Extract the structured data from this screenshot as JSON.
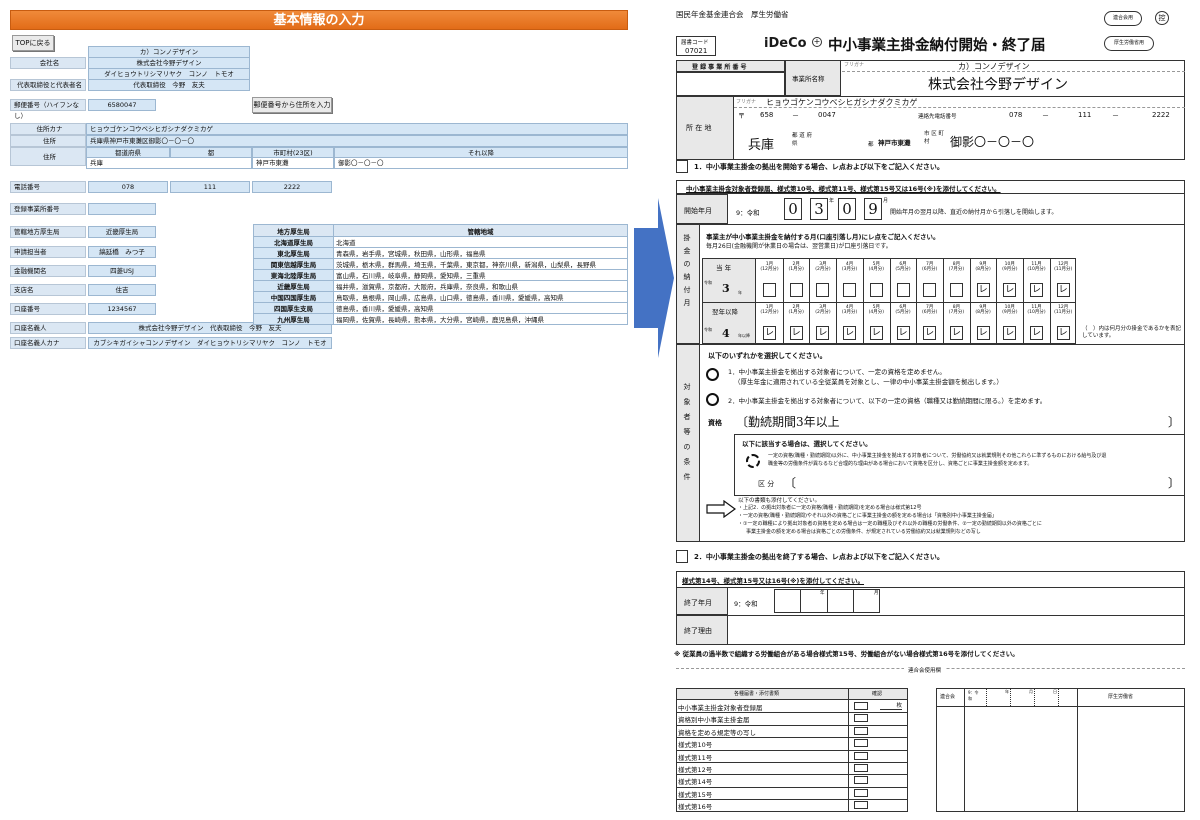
{
  "left": {
    "banner": "基本情報の入力",
    "top_button": "TOPに戻る",
    "kana_company": "カ）コンノデザイン",
    "company_label": "会社名",
    "company_name": "株式会社今野デザイン",
    "rep_kana": "ダイヒョウトリシマリヤク　コンノ　トモオ",
    "rep_label": "代表取締役と代表者名",
    "rep_name": "代表取締役　今野　友夫",
    "postal_label": "郵便番号（ハイフンなし）",
    "postal_value": "6580047",
    "postal_button": "郵便番号から住所を入力",
    "addr_kana_label": "住所カナ",
    "addr_kana": "ヒョウゴケンコウベシヒガシナダクミカゲ",
    "addr_label": "住所",
    "addr_full": "兵庫県神戸市東灘区御影〇－〇－〇",
    "addr2_label": "住所",
    "addr_headers": [
      "都道府県",
      "都",
      "市町村(23区)",
      "それ以降"
    ],
    "addr_pref": "兵庫",
    "addr_city": "神戸市東灘",
    "addr_rest": "御影〇－〇－〇",
    "phone_label": "電話番号",
    "phone": [
      "078",
      "111",
      "2222"
    ],
    "biz_no_label": "登録事業所番号",
    "bureau_label": "管轄地方厚生局",
    "bureau_value": "近畿厚生局",
    "applicant_label": "申請担当者",
    "applicant_value": "縞延橋　みつ子",
    "bank_label": "金融機関名",
    "bank_value": "四菱USJ",
    "branch_label": "支店名",
    "branch_value": "住吉",
    "account_label": "口座番号",
    "account_value": "1234567",
    "holder_label": "口座名義人",
    "holder_value": "株式会社今野デザイン　代表取締役　今野　友夫",
    "holder_kana_label": "口座名義人カナ",
    "holder_kana_value": "カブシキガイシャコンノデザイン　ダイヒョウトリシマリヤク　コンノ　トモオ",
    "bureau_table": {
      "headers": [
        "地方厚生局",
        "管轄地域"
      ],
      "rows": [
        [
          "北海道厚生局",
          "北海道"
        ],
        [
          "東北厚生局",
          "青森県，岩手県，宮城県，秋田県，山形県，福島県"
        ],
        [
          "関東信越厚生局",
          "茨城県，栃木県，群馬県，埼玉県，千葉県，東京都，神奈川県，新潟県，山梨県，長野県"
        ],
        [
          "東海北陸厚生局",
          "富山県，石川県，岐阜県，静岡県，愛知県，三重県"
        ],
        [
          "近畿厚生局",
          "福井県，滋賀県，京都府，大阪府，兵庫県，奈良県，和歌山県"
        ],
        [
          "中国四国厚生局",
          "鳥取県，島根県，岡山県，広島県，山口県，徳島県，香川県，愛媛県，高知県"
        ],
        [
          "四国厚生支局",
          "徳島県，香川県，愛媛県，高知県"
        ],
        [
          "九州厚生局",
          "福岡県，佐賀県，長崎県，熊本県，大分県，宮崎県，鹿児島県，沖縄県"
        ]
      ]
    }
  },
  "form": {
    "issuers": "国民年金基金連合会　厚生労働省",
    "stamp_pill": "連合会用",
    "stamp_mark": "控",
    "ministry_pill": "厚生労働省用",
    "doc_code_label": "届書コード",
    "doc_code": "07021",
    "logo": "iDeCo",
    "title": "中小事業主掛金納付開始・終了届",
    "reg_no_label": "登 録 事 業 所 番 号",
    "biz_name_label": "事業所名称",
    "furigana": "フリガナ",
    "furigana_name": "カ）コンノデザイン",
    "biz_name": "株式会社今野デザイン",
    "addr_label": "所 在 地",
    "addr_furigana_label": "フリガナ",
    "addr_furigana": "ヒョウゴケンコウベシヒガシナダクミカゲ",
    "zip_mark": "〒",
    "zip1": "658",
    "zip2": "0047",
    "phone_label": "連絡先電話番号",
    "phone": [
      "078",
      "111",
      "2222"
    ],
    "pref": "兵庫",
    "pref_suffix": "都 道 府 県",
    "city": "神戸市東灘",
    "city_suffix": "市 区 町 村",
    "rest": "御影〇－〇－〇",
    "sec1_title": "1．中小事業主掛金の拠出を開始する場合、レ点および以下をご記入ください。",
    "sec1_band": "中小事業主掛金対象者登録届、様式第10号、様式第11号、様式第15号又は16号(※)を添付してください。",
    "start_label": "開始年月",
    "era": "9：令和",
    "start_digits": [
      "0",
      "3",
      "0",
      "9"
    ],
    "year_mark": "年",
    "month_mark": "月",
    "start_note": "開始年月の翌月以降、直近の納付月から引落しを開始します。",
    "side_label": "掛 金 の 納 付 月",
    "pay_heading": "事業主が中小事業主掛金を納付する月(口座引落し月)にレ点をご記入ください。",
    "pay_sub": "毎月26日(金融機関が休業日の場合は、翌営業日)が口座引落日です。",
    "this_year": "当 年",
    "next_year": "翌年以降",
    "yr_this": "3",
    "yr_next": "4",
    "yr_prefix": "令和",
    "month_labels": [
      "1月",
      "2月",
      "3月",
      "4月",
      "5月",
      "6月",
      "7月",
      "8月",
      "9月",
      "10月",
      "11月",
      "12月"
    ],
    "month_subs": [
      "(12月分)",
      "(1月分)",
      "(2月分)",
      "(3月分)",
      "(4月分)",
      "(5月分)",
      "(6月分)",
      "(7月分)",
      "(8月分)",
      "(9月分)",
      "(10月分)",
      "(11月分)"
    ],
    "this_checks": [
      "",
      "",
      "",
      "",
      "",
      "",
      "",
      "",
      "レ",
      "レ",
      "レ",
      "レ"
    ],
    "next_checks": [
      "レ",
      "レ",
      "レ",
      "レ",
      "レ",
      "レ",
      "レ",
      "レ",
      "レ",
      "レ",
      "レ",
      "レ"
    ],
    "paren_note": "（　）内は何月分の掛金であるかを表記しています。",
    "target_side": "対 象 者 等 の 条 件",
    "select_heading": "以下のいずれかを選択してください。",
    "opt1": "1．中小事業主掛金を拠出する対象者について、一定の資格を定めません。",
    "opt1_sub": "（厚生年金に適用されている全従業員を対象とし、一律の中小事業主掛金額を拠出します。）",
    "opt2": "2．中小事業主掛金を拠出する対象者について、以下の一定の資格（職種又は勤続期間に限る。）を定めます。",
    "qual_label": "資格",
    "qual_value": "〔勤続期間3年以上",
    "qual_close": "〕",
    "qual_select": "以下に該当する場合は、選択してください。",
    "qual_text1": "一定の資格(職種・勤続期間)以外に、中小事業主掛金を拠出する対象者について、労働協約又は就業規則その他これらに準ずるものにおける給与及び退",
    "qual_text2": "職金等の労働条件が異なるなど合理的な理由がある場合において資格を区分し、資格ごとに事業主掛金額を定めます。",
    "kubun_label": "区 分",
    "kubun_open": "〔",
    "kubun_close": "〕",
    "attach_1": "以下の書類も添付してください。",
    "attach_2": "・上記2．の拠出対象者に一定の資格(職種・勤続期間)を定める場合は様式第12号",
    "attach_3": "・一定の資格(職種・勤続期間)やそれ以外の資格ごとに事業主掛金の額を定める場合は「資格別中小事業主掛金届」",
    "attach_4": "・①一定の職種により拠出対象者の資格を定める場合は一定の職種及びそれ以外の職種の労働条件、②一定の勤続期間以外の資格ごとに",
    "attach_5": "事業主掛金の額を定める場合は資格ごとの労働条件、が規定されている労働協約又は就業規則などの写し",
    "sec2_title": "2．中小事業主掛金の拠出を終了する場合、レ点および以下をご記入ください。",
    "sec2_band": "様式第14号、様式第15号又は16号(※)を添付してください。",
    "end_label": "終了年月",
    "end_era": "9：令和",
    "end_year": "年",
    "end_month": "月",
    "reason_label": "終了理由",
    "footnote": "※ 従業員の過半数で組織する労働組合がある場合様式第15号、労働組合がない場合様式第16号を添付してください。",
    "office_use": "連合会使用欄",
    "docs_header": "各種届書・添付書類",
    "confirm_header": "確認",
    "docs": [
      "中小事業主掛金対象者登録届",
      "資格別中小事業主掛金届",
      "資格を定める規定等の写し",
      "様式第10号",
      "様式第11号",
      "様式第12号",
      "様式第14号",
      "様式第15号",
      "様式第16号"
    ],
    "count_unit": "枚",
    "rengokai": "連合会",
    "reiwa_short": "9：令和",
    "y": "年",
    "m": "月",
    "d": "日",
    "mhlw": "厚生労働省"
  }
}
